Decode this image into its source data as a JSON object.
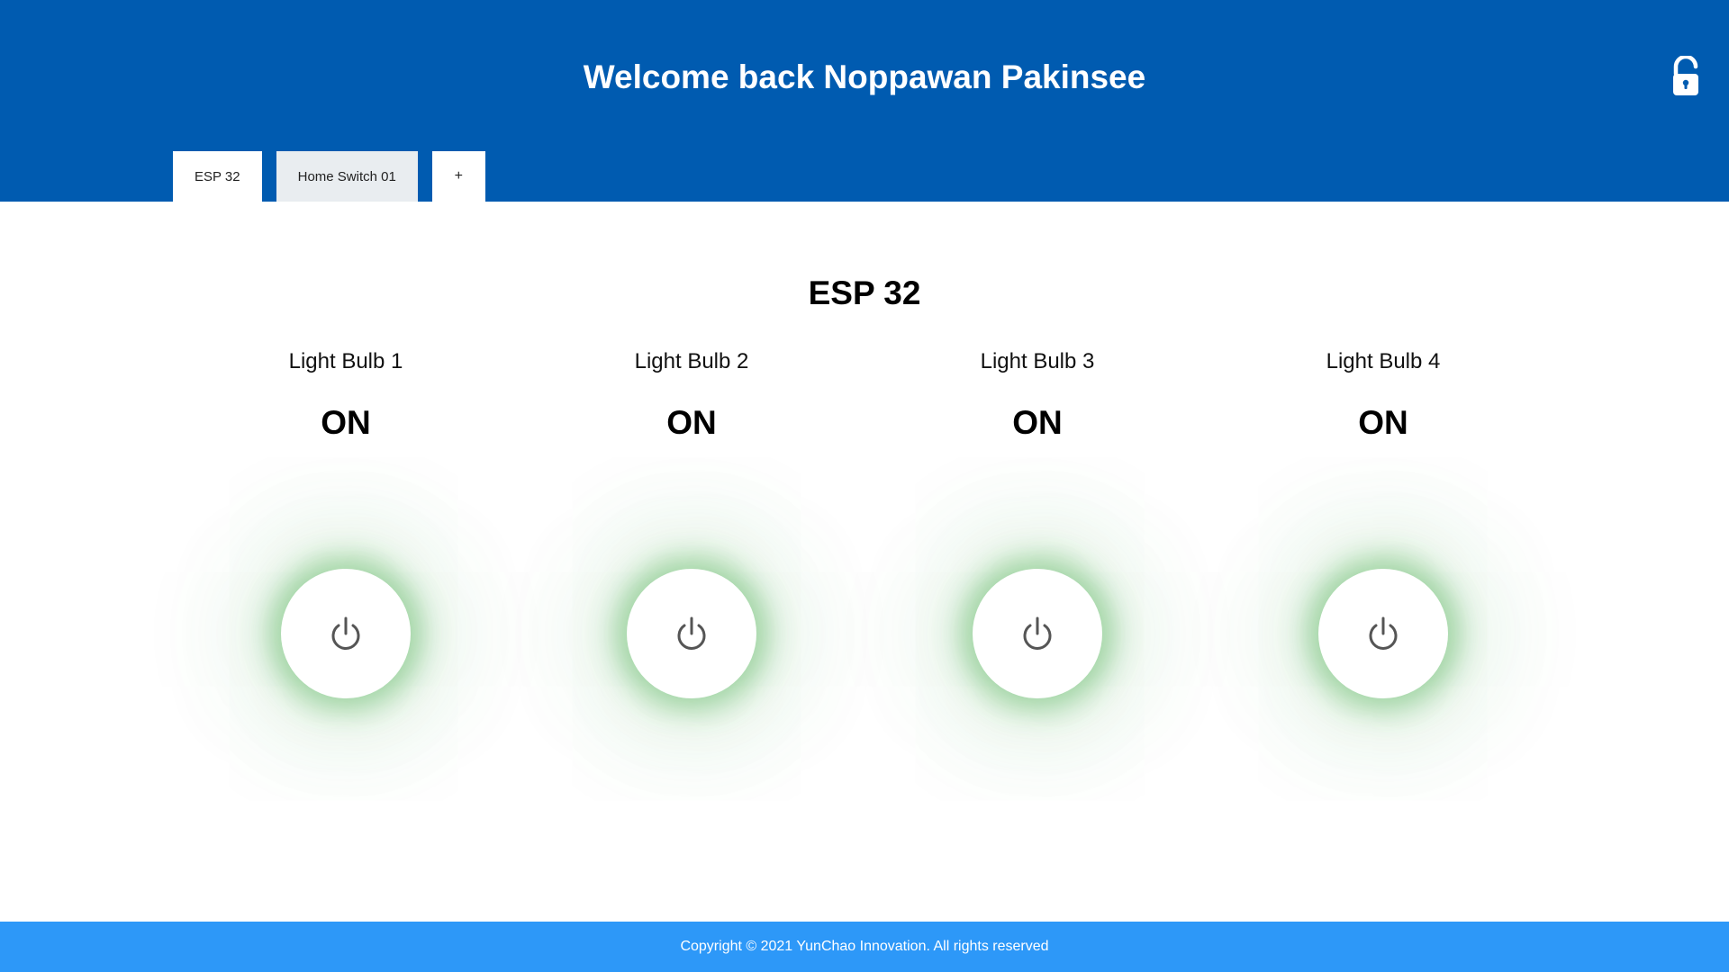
{
  "header": {
    "title": "Welcome back Noppawan Pakinsee",
    "lock_icon": "unlock-icon",
    "bg_color": "#005bb0"
  },
  "tabs": [
    {
      "label": "ESP 32",
      "active": true
    },
    {
      "label": "Home Switch 01",
      "active": false
    },
    {
      "label": "+",
      "active": false
    }
  ],
  "main": {
    "title": "ESP 32",
    "devices": [
      {
        "name": "Light Bulb 1",
        "state": "ON",
        "icon": "power-icon"
      },
      {
        "name": "Light Bulb 2",
        "state": "ON",
        "icon": "power-icon"
      },
      {
        "name": "Light Bulb 3",
        "state": "ON",
        "icon": "power-icon"
      },
      {
        "name": "Light Bulb 4",
        "state": "ON",
        "icon": "power-icon"
      }
    ],
    "on_glow_color": "#4caf50"
  },
  "footer": {
    "text": "Copyright © 2021 YunChao Innovation. All rights reserved",
    "bg_color": "#2d98f8"
  }
}
